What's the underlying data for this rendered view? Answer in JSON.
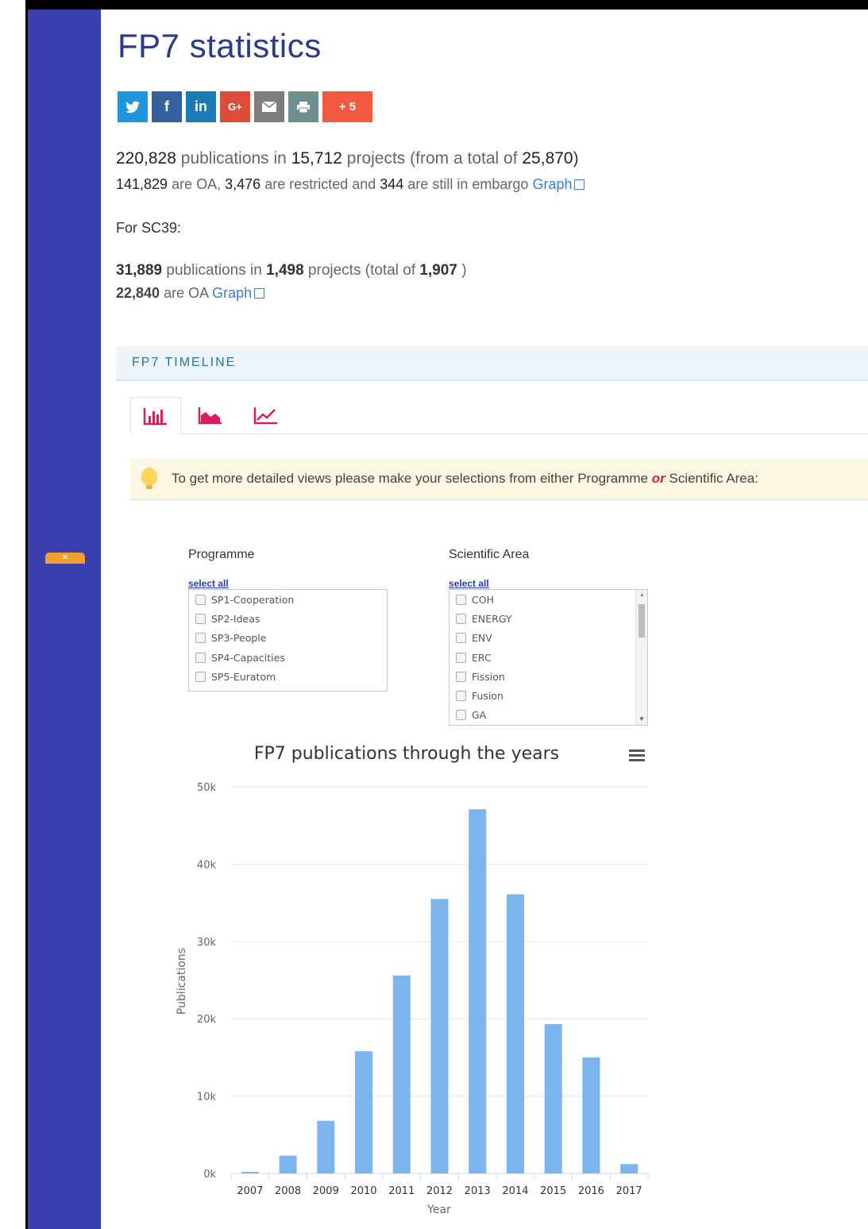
{
  "page": {
    "title": "FP7 statistics"
  },
  "share": {
    "more_label": "+ 5",
    "gplus_label": "G+"
  },
  "stats": {
    "publications": "220,828",
    "pub_word": "publications in",
    "projects": "15,712",
    "projects_word": "projects (from a total of",
    "total": "25,870",
    "close": ")",
    "oa": "141,829",
    "oa_word": "are OA,",
    "restricted": "3,476",
    "restricted_word": "are restricted and",
    "embargo": "344",
    "embargo_word": "are still in embargo",
    "graph_link": "Graph"
  },
  "sc": {
    "label": "For SC39:",
    "publications": "31,889",
    "pub_word": "publications in",
    "projects": "1,498",
    "projects_word": "projects (total of",
    "total": "1,907",
    "close": ")",
    "oa": "22,840",
    "oa_word": "are OA",
    "graph_link": "Graph"
  },
  "timeline": {
    "title": "FP7 TIMELINE"
  },
  "tabs": [
    "bar-chart-icon",
    "area-chart-icon",
    "line-chart-icon"
  ],
  "hint": {
    "text_before": "To get more detailed views please make your selections from either",
    "programme": "Programme",
    "or": "or",
    "sci": "Scientific Area:"
  },
  "programme": {
    "title": "Programme",
    "select_all": "select all",
    "items": [
      "SP1-Cooperation",
      "SP2-Ideas",
      "SP3-People",
      "SP4-Capacities",
      "SP5-Euratom"
    ]
  },
  "scientific_area": {
    "title": "Scientific Area",
    "select_all": "select all",
    "items": [
      "COH",
      "ENERGY",
      "ENV",
      "ERC",
      "Fission",
      "Fusion",
      "GA"
    ]
  },
  "colors": {
    "accent": "#3b3fae",
    "bar": "#7cb5ec",
    "icon": "#d61f5c"
  },
  "chart_data": {
    "type": "bar",
    "title": "FP7 publications through the years",
    "xlabel": "Year",
    "ylabel": "Publications",
    "categories": [
      "2007",
      "2008",
      "2009",
      "2010",
      "2011",
      "2012",
      "2013",
      "2014",
      "2015",
      "2016",
      "2017"
    ],
    "values": [
      200,
      2300,
      6800,
      15800,
      25600,
      35500,
      47100,
      36100,
      19300,
      15000,
      1200
    ],
    "ylim": [
      0,
      50000
    ],
    "yticks": [
      "0k",
      "10k",
      "20k",
      "30k",
      "40k",
      "50k"
    ],
    "grid": true
  }
}
